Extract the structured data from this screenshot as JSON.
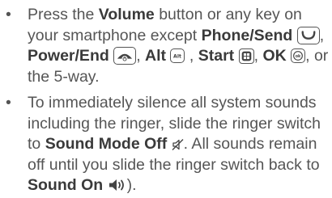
{
  "bullets": [
    {
      "segments": [
        {
          "t": "Press the "
        },
        {
          "t": "Volume",
          "b": true
        },
        {
          "t": " button or any key on your smartphone except "
        },
        {
          "t": "Phone/Send",
          "b": true
        },
        {
          "t": " ",
          "icon": "phone-send-key-icon"
        },
        {
          "t": ", "
        },
        {
          "t": "Power/End",
          "b": true
        },
        {
          "t": " ",
          "icon": "power-end-key-icon"
        },
        {
          "t": ", "
        },
        {
          "t": "Alt",
          "b": true
        },
        {
          "t": " ",
          "icon": "alt-key-icon"
        },
        {
          "t": " , "
        },
        {
          "t": "Start",
          "b": true
        },
        {
          "t": " ",
          "icon": "start-key-icon"
        },
        {
          "t": ", "
        },
        {
          "t": "OK",
          "b": true
        },
        {
          "t": " ",
          "icon": "ok-key-icon"
        },
        {
          "t": ", or the 5-way."
        }
      ]
    },
    {
      "segments": [
        {
          "t": "To immediately silence all system sounds including the ringer, slide the ringer switch to "
        },
        {
          "t": "Sound Mode Off",
          "b": true
        },
        {
          "t": " ",
          "icon": "sound-off-icon"
        },
        {
          "t": ". All sounds remain off until you slide the ringer switch back to "
        },
        {
          "t": "Sound On",
          "b": true
        },
        {
          "t": " ",
          "icon": "sound-on-icon"
        },
        {
          "t": ")."
        }
      ]
    }
  ],
  "bullet_char": "•",
  "text_color": "#555555",
  "bold_color": "#3a3a3a"
}
